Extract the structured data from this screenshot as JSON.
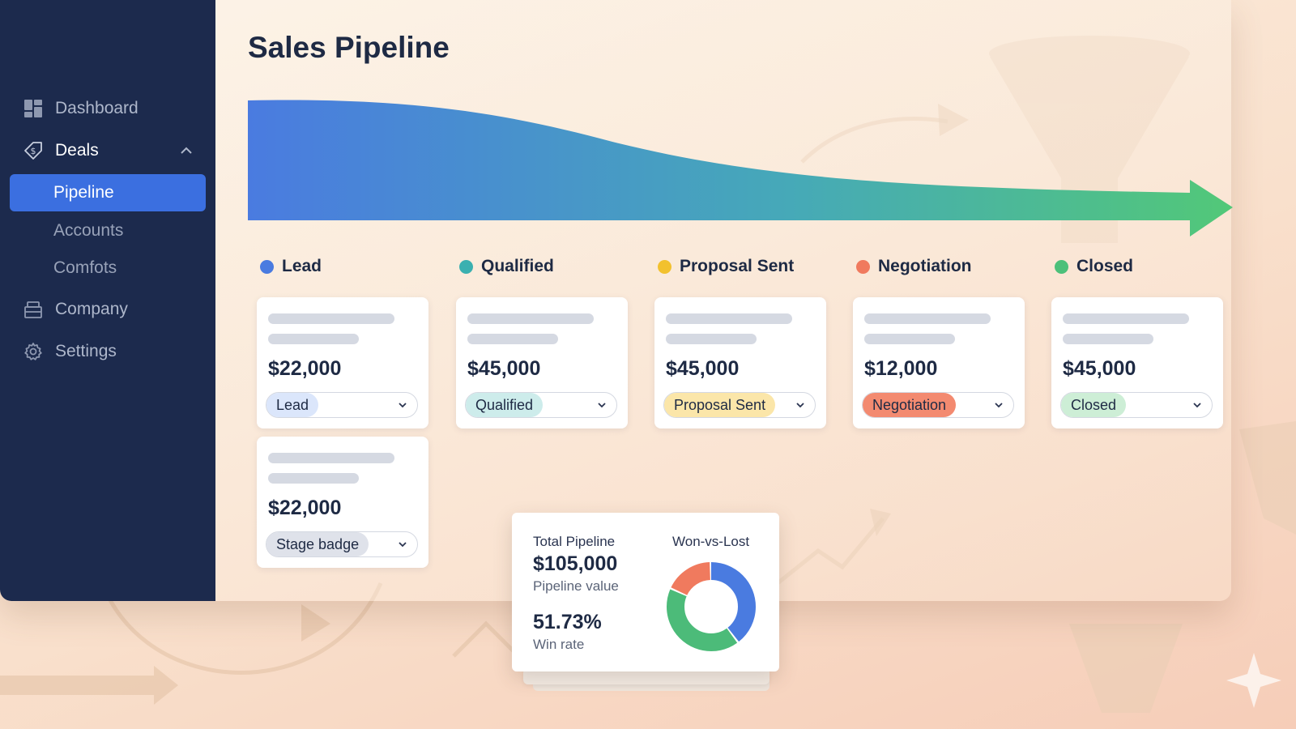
{
  "page": {
    "title": "Sales Pipeline"
  },
  "sidebar": {
    "items": [
      {
        "label": "Dashboard",
        "icon": "dashboard-icon"
      },
      {
        "label": "Deals",
        "icon": "price-tag-icon",
        "expanded": true
      },
      {
        "label": "Company",
        "icon": "building-icon"
      },
      {
        "label": "Settings",
        "icon": "gear-icon"
      }
    ],
    "deals_subitems": [
      {
        "label": "Pipeline",
        "active": true
      },
      {
        "label": "Accounts",
        "active": false
      },
      {
        "label": "Comfots",
        "active": false
      }
    ]
  },
  "columns": [
    {
      "name": "Lead",
      "dot_color": "#4a7be0",
      "bg": "#f4f2f2",
      "cards": [
        {
          "amount": "$22,000",
          "stage": "Lead",
          "pill_color": "#dbe6fb"
        },
        {
          "amount": "$22,000",
          "stage": "Stage badge",
          "pill_color": "#dfe2ea"
        }
      ]
    },
    {
      "name": "Qualified",
      "dot_color": "#3bb0b0",
      "bg": "#e9f1f3",
      "cards": [
        {
          "amount": "$45,000",
          "stage": "Qualified",
          "pill_color": "#cdeceb"
        }
      ]
    },
    {
      "name": "Proposal Sent",
      "dot_color": "#f2c12e",
      "bg": "#fbf1de",
      "cards": [
        {
          "amount": "$45,000",
          "stage": "Proposal Sent",
          "pill_color": "#fbe6a9"
        }
      ]
    },
    {
      "name": "Negotiation",
      "dot_color": "#f07a5e",
      "bg": "#fbe7da",
      "cards": [
        {
          "amount": "$12,000",
          "stage": "Negotiation",
          "pill_color": "#f38a70"
        }
      ]
    },
    {
      "name": "Closed",
      "dot_color": "#4cc07a",
      "bg": "#fbeae2",
      "cards": [
        {
          "amount": "$45,000",
          "stage": "Closed",
          "pill_color": "#cdeed6"
        }
      ]
    }
  ],
  "summary": {
    "total_label": "Total Pipeline",
    "total_value": "$105,000",
    "total_sub": "Pipeline value",
    "win_rate_value": "51.73%",
    "win_rate_label": "Win rate",
    "donut_title": "Won-vs-Lost",
    "donut_segments": [
      {
        "color": "#4a7be0",
        "fraction": 0.4
      },
      {
        "color": "#4cbb79",
        "fraction": 0.42
      },
      {
        "color": "#f07a5e",
        "fraction": 0.18
      }
    ]
  },
  "colors": {
    "sidebar_bg": "#1c2a4d",
    "active_nav": "#3b6fe0",
    "flow_start": "#4a7be0",
    "flow_end": "#52c878"
  }
}
